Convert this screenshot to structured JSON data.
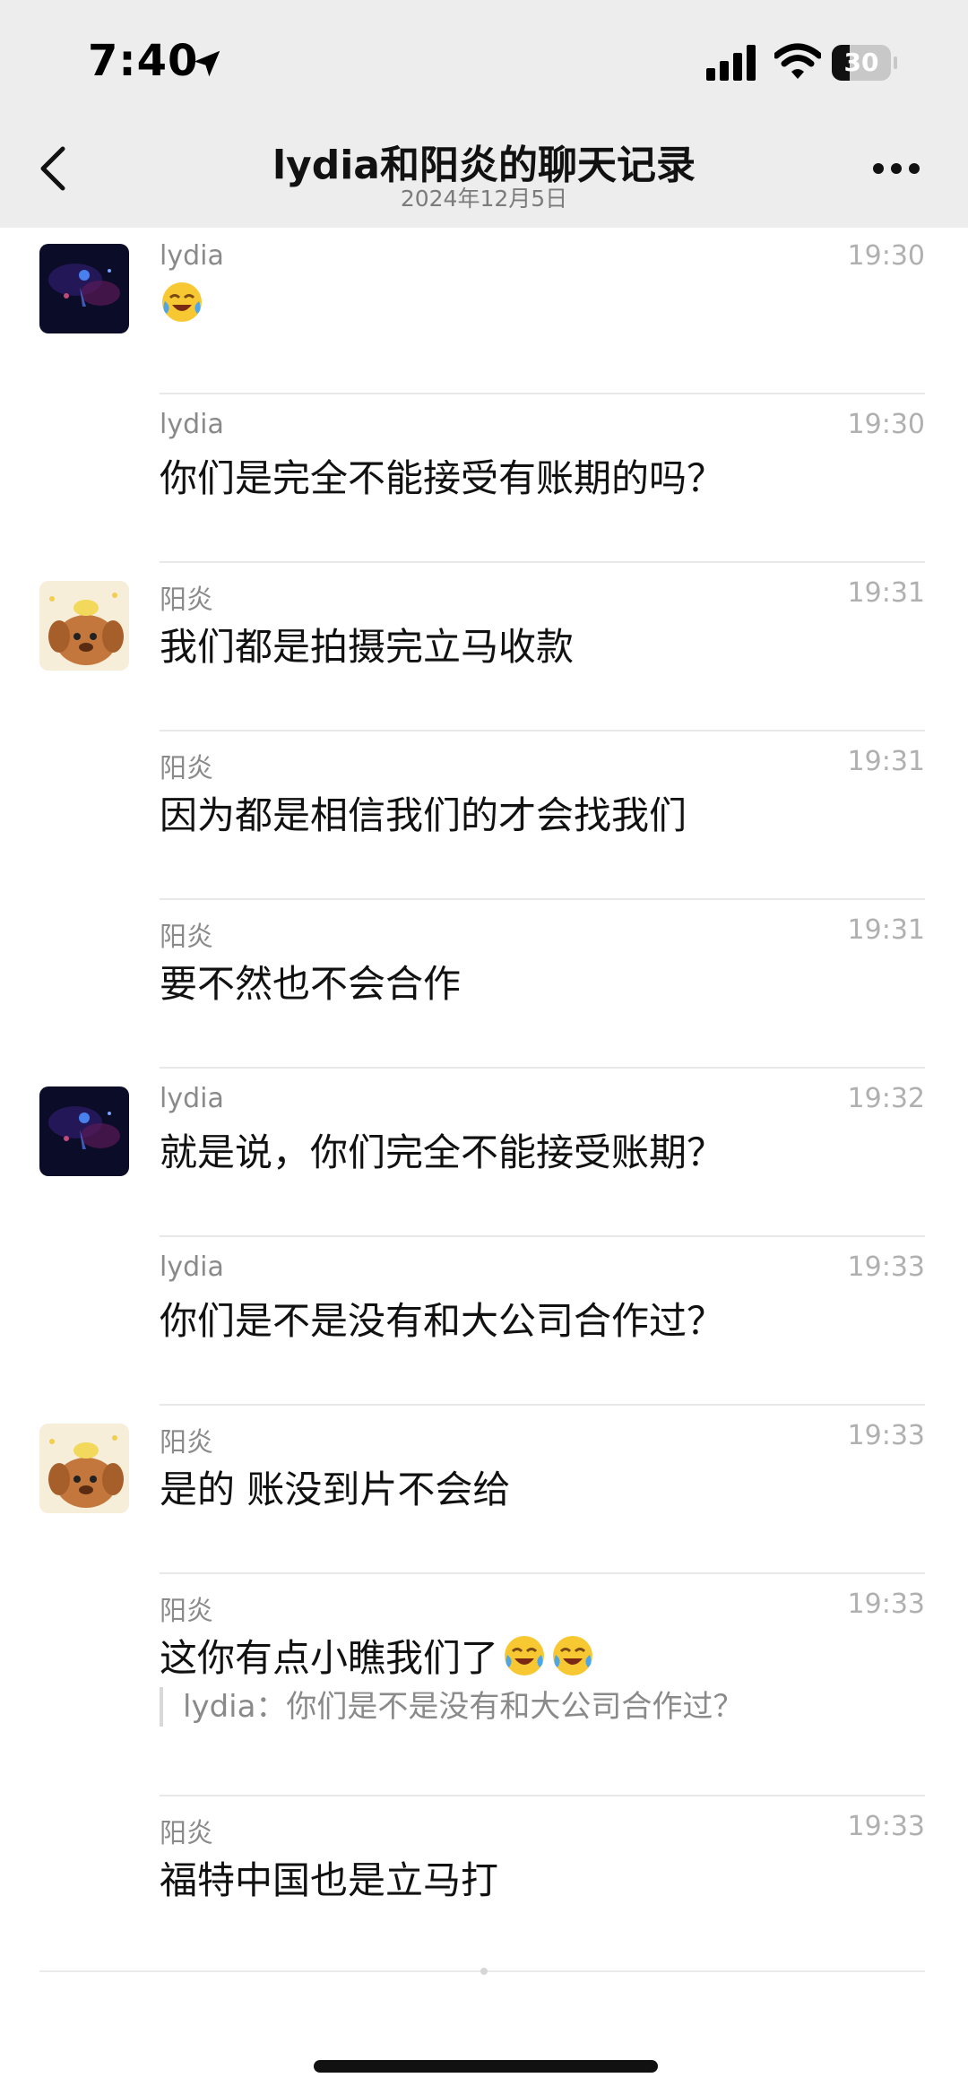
{
  "status_bar": {
    "time": "7:40",
    "battery": "30",
    "battery_level": 0.3
  },
  "header": {
    "title": "lydia和阳炎的聊天记录",
    "subtitle": "2024年12月5日"
  },
  "messages": [
    {
      "sender": "lydia",
      "time": "19:30",
      "text": "",
      "emojis": [
        "crying-laughing-emoji"
      ],
      "avatar": "night-photo"
    },
    {
      "sender": "lydia",
      "time": "19:30",
      "text": "你们是完全不能接受有账期的吗？"
    },
    {
      "sender": "阳炎",
      "time": "19:31",
      "text": "我们都是拍摄完立马收款",
      "avatar": "cartoon-dog"
    },
    {
      "sender": "阳炎",
      "time": "19:31",
      "text": "因为都是相信我们的才会找我们"
    },
    {
      "sender": "阳炎",
      "time": "19:31",
      "text": "要不然也不会合作"
    },
    {
      "sender": "lydia",
      "time": "19:32",
      "text": "就是说，你们完全不能接受账期？",
      "avatar": "night-photo"
    },
    {
      "sender": "lydia",
      "time": "19:33",
      "text": "你们是不是没有和大公司合作过？"
    },
    {
      "sender": "阳炎",
      "time": "19:33",
      "text": "是的 账没到片不会给",
      "avatar": "cartoon-dog"
    },
    {
      "sender": "阳炎",
      "time": "19:33",
      "text": "这你有点小瞧我们了",
      "emojis": [
        "crying-laughing-emoji",
        "crying-laughing-emoji"
      ],
      "quote": "lydia：你们是不是没有和大公司合作过？"
    },
    {
      "sender": "阳炎",
      "time": "19:33",
      "text": "福特中国也是立马打"
    }
  ]
}
